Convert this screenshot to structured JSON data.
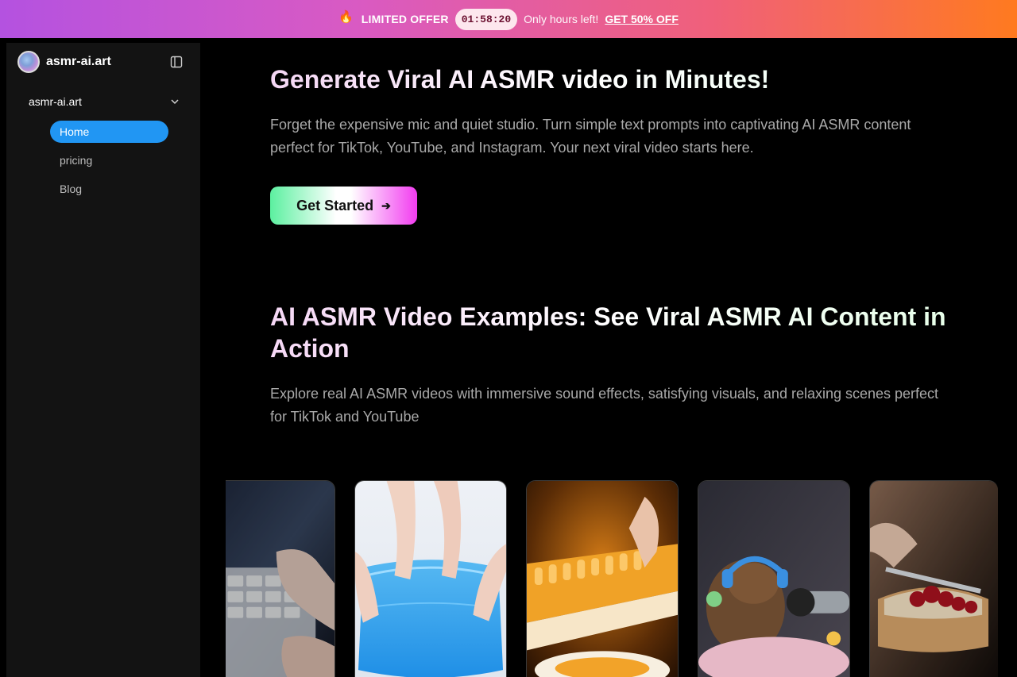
{
  "promo": {
    "fire_icon": "🔥",
    "offer_label": "LIMITED OFFER",
    "timer": "01:58:20",
    "hours_text": "Only hours left!",
    "cta_label": "GET 50% OFF"
  },
  "sidebar": {
    "brand_name": "asmr-ai.art",
    "group_label": "asmr-ai.art",
    "items": [
      {
        "label": "Home",
        "active": true
      },
      {
        "label": "pricing",
        "active": false
      },
      {
        "label": "Blog",
        "active": false
      }
    ]
  },
  "hero": {
    "title": "Generate Viral AI ASMR video in Minutes!",
    "description": "Forget the expensive mic and quiet studio. Turn simple text prompts into captivating AI ASMR content perfect for TikTok, YouTube, and Instagram. Your next viral video starts here.",
    "cta_label": "Get Started",
    "cta_icon": "arrow-right-icon"
  },
  "examples": {
    "title": "AI ASMR Video Examples: See Viral ASMR AI Content in Action",
    "description": "Explore real AI ASMR videos with immersive sound effects, satisfying visuals, and relaxing scenes perfect for TikTok and YouTube",
    "cards": [
      {
        "subject": "hands typing on keyboard"
      },
      {
        "subject": "hands pressing blue jelly"
      },
      {
        "subject": "honey glass piano keys"
      },
      {
        "subject": "capybara with headphones and microphone"
      },
      {
        "subject": "knife spreading jam on toast"
      }
    ]
  },
  "colors": {
    "accent": "#2196f3",
    "banner_start": "#b452e0",
    "banner_end": "#ff7a1f",
    "sidebar_bg": "#131313"
  }
}
